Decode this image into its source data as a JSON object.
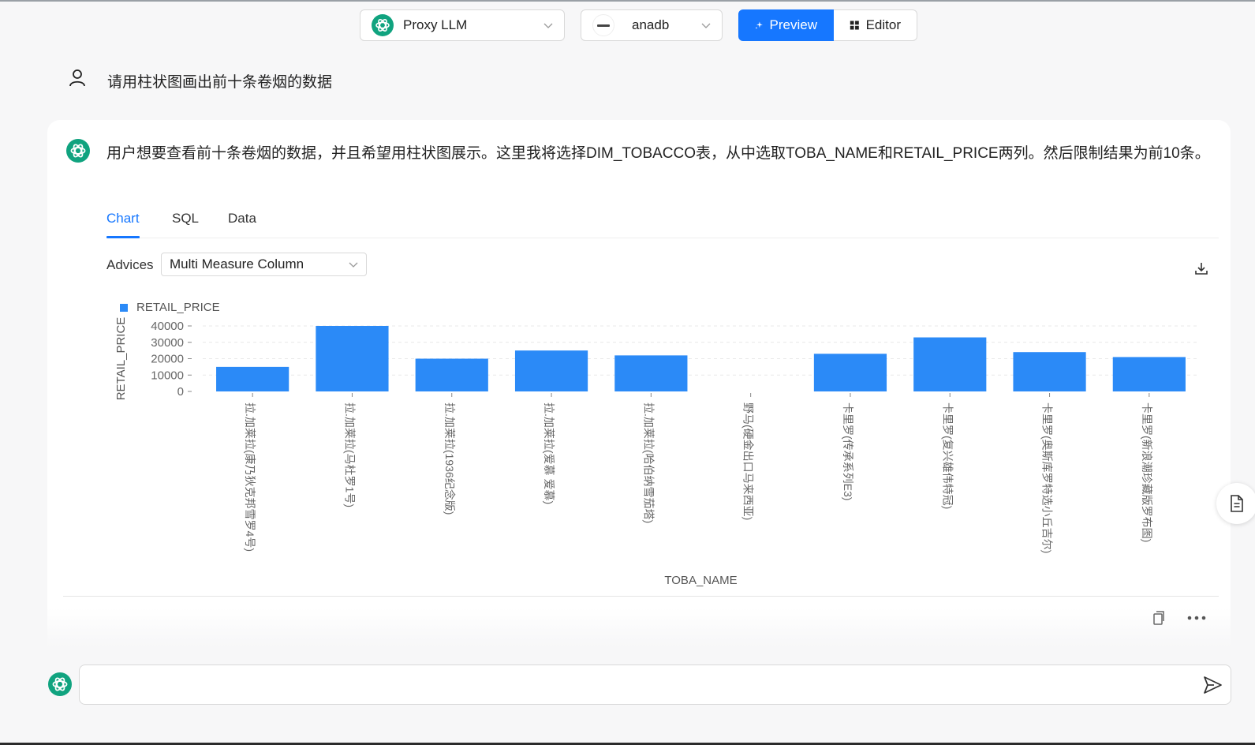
{
  "topbar": {
    "model_select": "Proxy LLM",
    "db_select": "anadb",
    "preview_label": "Preview",
    "editor_label": "Editor"
  },
  "user_message": "请用柱状图画出前十条卷烟的数据",
  "assistant": {
    "message": "用户想要查看前十条卷烟的数据，并且希望用柱状图展示。这里我将选择DIM_TOBACCO表，从中选取TOBA_NAME和RETAIL_PRICE两列。然后限制结果为前10条。",
    "tabs": [
      "Chart",
      "SQL",
      "Data"
    ],
    "active_tab": "Chart",
    "advices_label": "Advices",
    "advices_value": "Multi Measure Column"
  },
  "chat_input": {
    "value": "",
    "placeholder": ""
  },
  "colors": {
    "accent": "#1677ff",
    "bar": "#2b8af7",
    "gpt_green": "#10a37f"
  },
  "icons": {
    "user": "user-icon",
    "download": "download-icon",
    "copy": "copy-icon",
    "more": "more-icon",
    "send": "send-icon",
    "document": "document-icon"
  },
  "chart_data": {
    "type": "bar",
    "legend": "RETAIL_PRICE",
    "legend_position": "top-left",
    "xlabel": "TOBA_NAME",
    "ylabel": "RETAIL_PRICE",
    "ylim": [
      0,
      40000
    ],
    "yticks": [
      0,
      10000,
      20000,
      30000,
      40000
    ],
    "grid": "horizontal-dashed",
    "categories": [
      "拉.加莱拉(康乃狄克邦雪罗4号)",
      "拉.加莱拉(马杜罗1号)",
      "拉.加莱拉(1936纪念版)",
      "拉.加莱拉(爱慕 爱慕)",
      "拉.加莱拉(哈伯纳雪茄塔)",
      "野马(硬金出口马来西亚)",
      "卡里罗(传承系列E3)",
      "卡里罗(复兴雄伟特冠)",
      "卡里罗(奥斯库罗特选小丘吉尔)",
      "卡里罗(新浪潮珍藏版罗布图)"
    ],
    "values": [
      15000,
      40000,
      20000,
      25000,
      22000,
      0,
      23000,
      33000,
      24000,
      21000
    ]
  }
}
